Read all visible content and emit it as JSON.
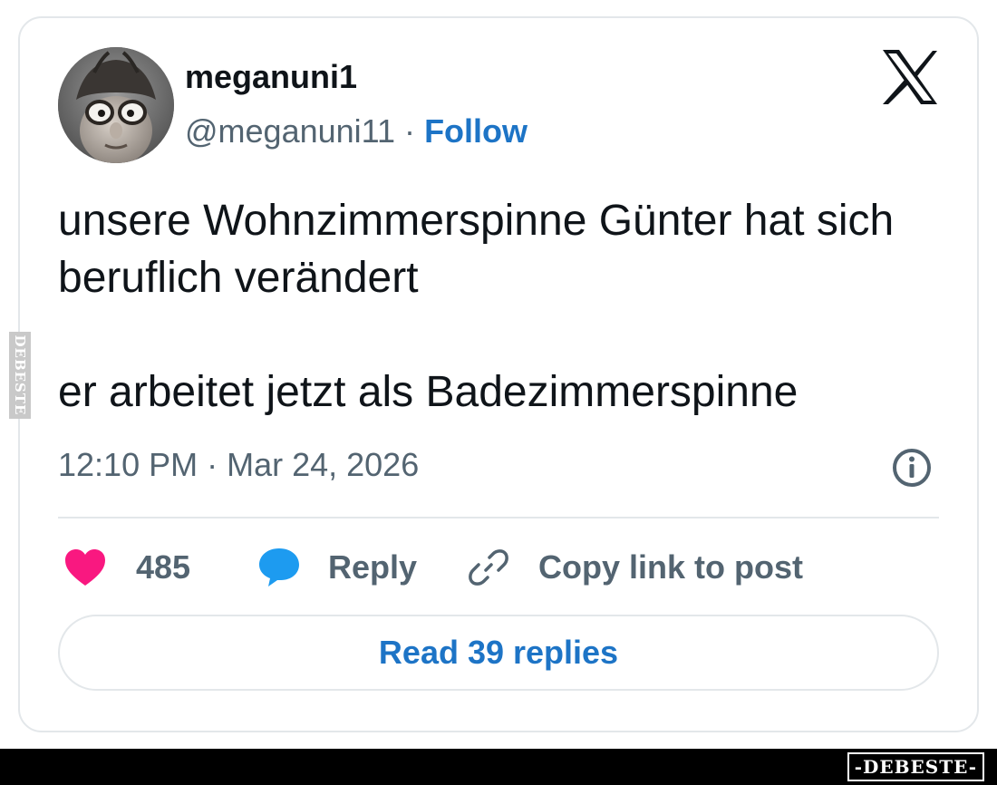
{
  "tweet": {
    "display_name": "meganuni1",
    "handle": "@meganuni11",
    "separator": "·",
    "follow_label": "Follow",
    "text_paragraphs": [
      "unsere Wohnzimmerspinne Günter hat sich beruflich verändert",
      "er arbeitet jetzt als Badezimmerspinne"
    ],
    "timestamp": "12:10 PM · Mar 24, 2026"
  },
  "actions": {
    "like": {
      "icon": "heart-icon",
      "count": "485",
      "color": "#f91880"
    },
    "reply": {
      "icon": "speech-bubble-icon",
      "label": "Reply",
      "color": "#1d9bf0"
    },
    "copy": {
      "icon": "link-icon",
      "label": "Copy link to post"
    }
  },
  "read_replies_label": "Read 39 replies",
  "icons": {
    "platform_logo": "x-logo-icon",
    "info": "info-icon"
  },
  "watermark": {
    "side_text": "DEBESTE",
    "footer_logo": "-DEBESTE-"
  },
  "colors": {
    "accent": "#1d74c6",
    "text": "#0f1419",
    "muted": "#536471",
    "border": "#e3e7ea",
    "like": "#f91880",
    "reply": "#1d9bf0"
  }
}
